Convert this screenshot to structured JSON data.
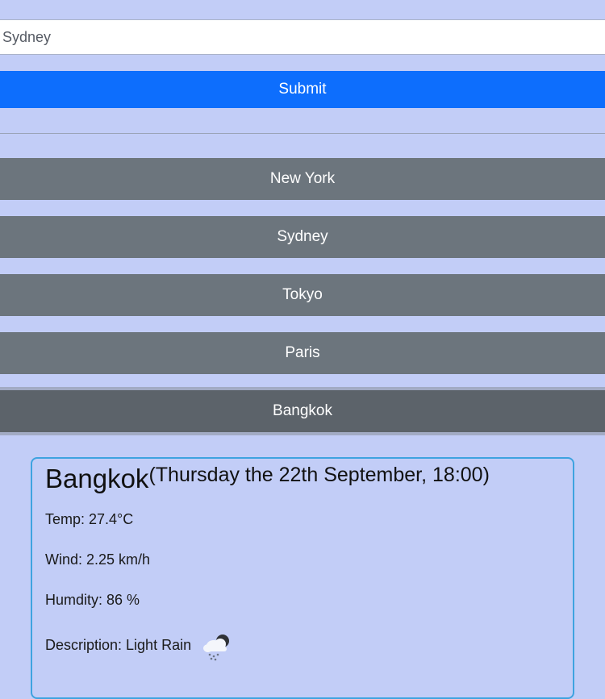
{
  "search": {
    "value": "Sydney",
    "submit_label": "Submit"
  },
  "history": [
    {
      "label": "New York"
    },
    {
      "label": "Sydney"
    },
    {
      "label": "Tokyo"
    },
    {
      "label": "Paris"
    },
    {
      "label": "Bangkok"
    }
  ],
  "weather": {
    "city": "Bangkok",
    "date": "(Thursday the 22th September, 18:00)",
    "temp": "Temp: 27.4°C",
    "wind": "Wind: 2.25 km/h",
    "humidity": "Humdity: 86 %",
    "description": "Description: Light Rain",
    "icon": "light-rain-icon"
  },
  "colors": {
    "background": "#c2cdf7",
    "submit": "#0d6efd",
    "history_button": "#6c757d",
    "history_button_active": "#5c636a",
    "card_border": "#3ea3e0"
  }
}
